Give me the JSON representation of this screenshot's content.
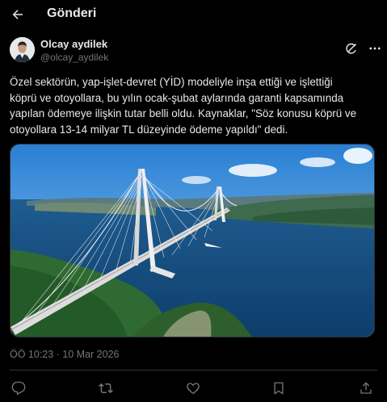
{
  "header": {
    "title": "Gönderi",
    "back_icon": "arrow-left-icon"
  },
  "author": {
    "name": "Olcay aydilek",
    "handle": "@olcay_aydilek"
  },
  "header_actions": {
    "grok_icon": "grok-icon",
    "more_icon": "more-horizontal-icon"
  },
  "post": {
    "lines": [
      "Özel sektörün, yap-işlet-devret (YİD) modeliyle inşa ettiği ve işlettiği",
      "köprü ve otoyollara, bu yılın ocak-şubat aylarında garanti kapsamında",
      "yapılan ödemeye ilişkin tutar belli oldu. Kaynaklar, \"Söz konusu köprü ve",
      "otoyollara 13-14 milyar TL düzeyinde ödeme yapıldı\" dedi."
    ],
    "timestamp": "ÖÖ 10:23 · 10 Mar 2026",
    "media_icon": "suspension-bridge-photo"
  },
  "actions": {
    "reply_icon": "reply-icon",
    "repost_icon": "repost-icon",
    "like_icon": "like-icon",
    "bookmark_icon": "bookmark-icon",
    "share_icon": "share-icon"
  },
  "colors": {
    "background": "#000000",
    "text_primary": "#e7e9ea",
    "text_secondary": "#71767b",
    "divider": "#2f3336"
  }
}
